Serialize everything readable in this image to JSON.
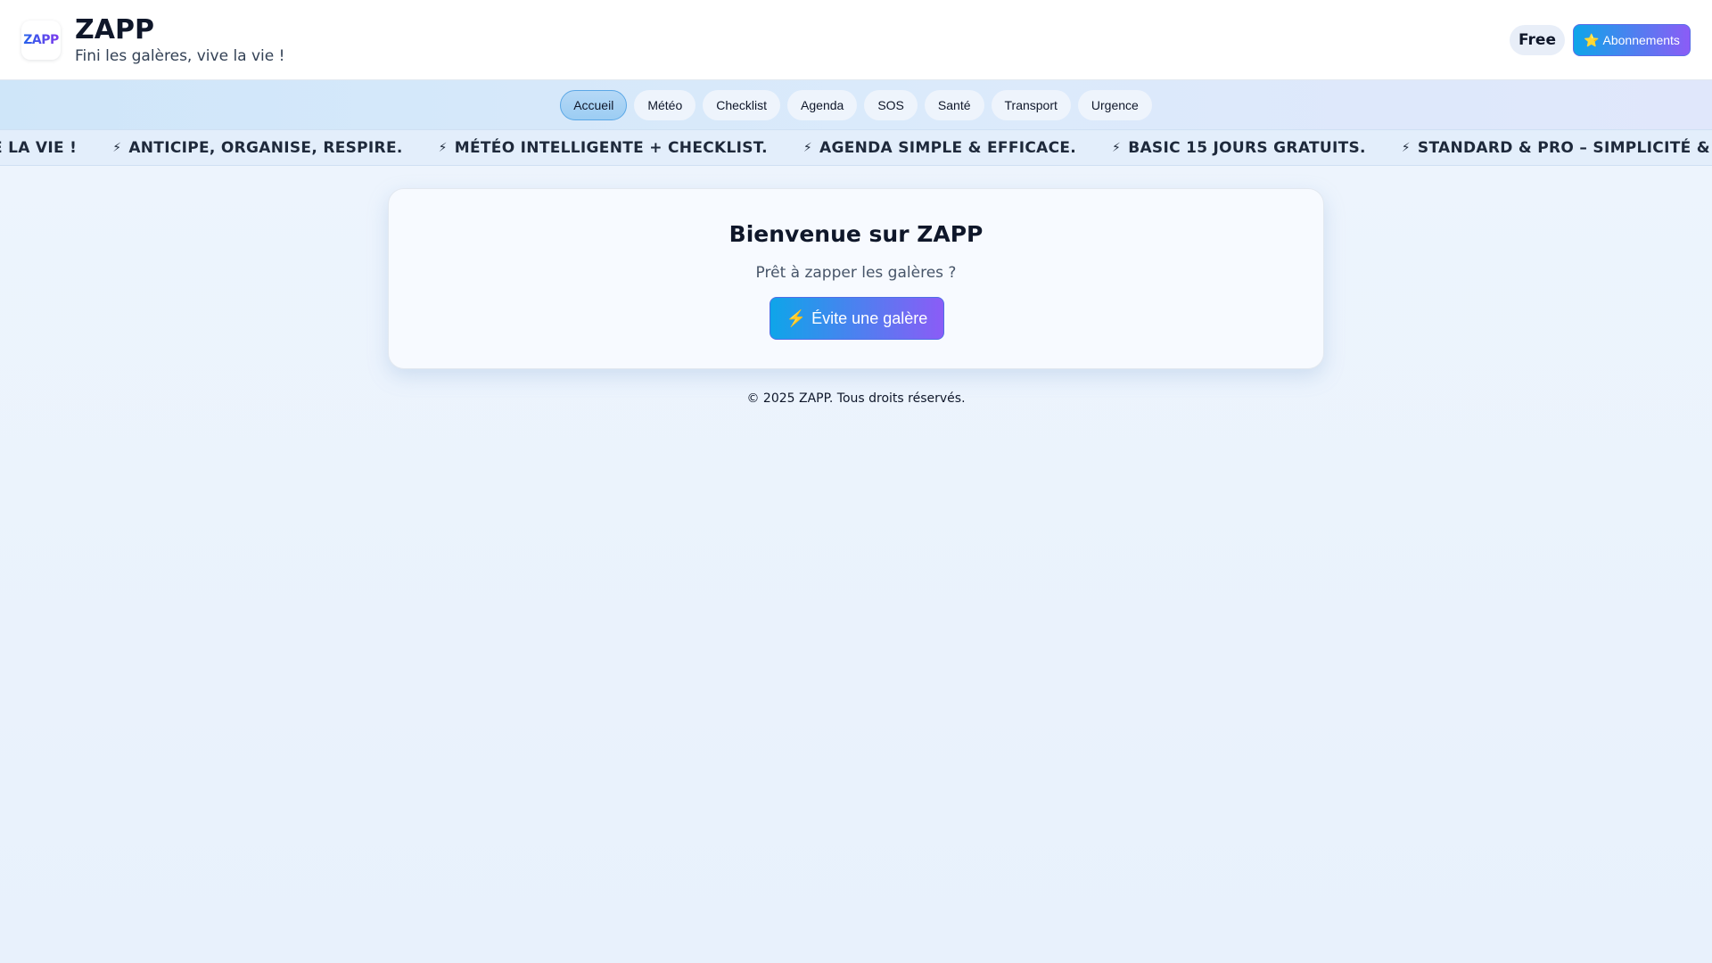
{
  "header": {
    "logo_text": "ZAPP",
    "title": "ZAPP",
    "tagline": "Fini les galères, vive la vie !",
    "plan_badge": "Free",
    "subscriptions_icon": "⭐",
    "subscriptions_label": "Abonnements"
  },
  "nav": {
    "tabs": [
      {
        "label": "Accueil",
        "active": true
      },
      {
        "label": "Météo",
        "active": false
      },
      {
        "label": "Checklist",
        "active": false
      },
      {
        "label": "Agenda",
        "active": false
      },
      {
        "label": "SOS",
        "active": false
      },
      {
        "label": "Santé",
        "active": false
      },
      {
        "label": "Transport",
        "active": false
      },
      {
        "label": "Urgence",
        "active": false
      }
    ]
  },
  "ticker": {
    "bolt": "⚡",
    "items": [
      "FINI LES GALÈRES, VIVE LA VIE !",
      "ANTICIPE, ORGANISE, RESPIRE.",
      "MÉTÉO INTELLIGENTE + CHECKLIST.",
      "AGENDA SIMPLE & EFFICACE.",
      "BASIC 15 JOURS GRATUITS.",
      "STANDARD & PRO – SIMPLICITÉ & PUISSANCE."
    ]
  },
  "welcome": {
    "title": "Bienvenue sur ZAPP",
    "subtitle": "Prêt à zapper les galères ?",
    "cta_icon": "⚡",
    "cta_label": "Évite une galère"
  },
  "footer": {
    "text": "© 2025 ZAPP. Tous droits réservés."
  },
  "colors": {
    "accent_start": "#0ea5e9",
    "accent_end": "#8b5cf6",
    "page_bg": "#eef5fd"
  }
}
